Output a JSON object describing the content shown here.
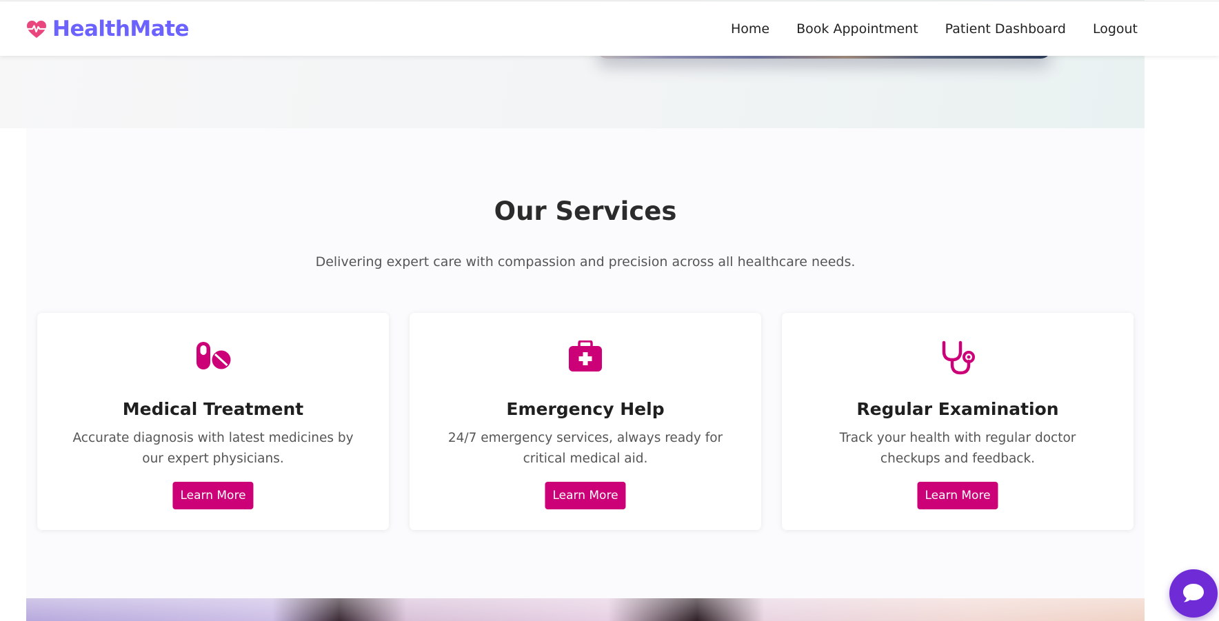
{
  "brand": {
    "name": "HealthMate",
    "icon": "heart-pulse-icon",
    "color": "#6c63ff",
    "icon_color": "#e8467c"
  },
  "nav": {
    "links": [
      "Home",
      "Book Appointment",
      "Patient Dashboard",
      "Logout"
    ]
  },
  "services": {
    "title": "Our Services",
    "subtitle": "Delivering expert care with compassion and precision across all healthcare needs.",
    "accent_color": "#cc0077",
    "cards": [
      {
        "icon": "pills-icon",
        "title": "Medical Treatment",
        "description": "Accurate diagnosis with latest medicines by our expert physicians.",
        "button": "Learn More"
      },
      {
        "icon": "first-aid-kit-icon",
        "title": "Emergency Help",
        "description": "24/7 emergency services, always ready for critical medical aid.",
        "button": "Learn More"
      },
      {
        "icon": "stethoscope-icon",
        "title": "Regular Examination",
        "description": "Track your health with regular doctor checkups and feedback.",
        "button": "Learn More"
      }
    ]
  },
  "chat": {
    "icon": "chat-bubble-icon",
    "color": "#6f2bd6"
  }
}
